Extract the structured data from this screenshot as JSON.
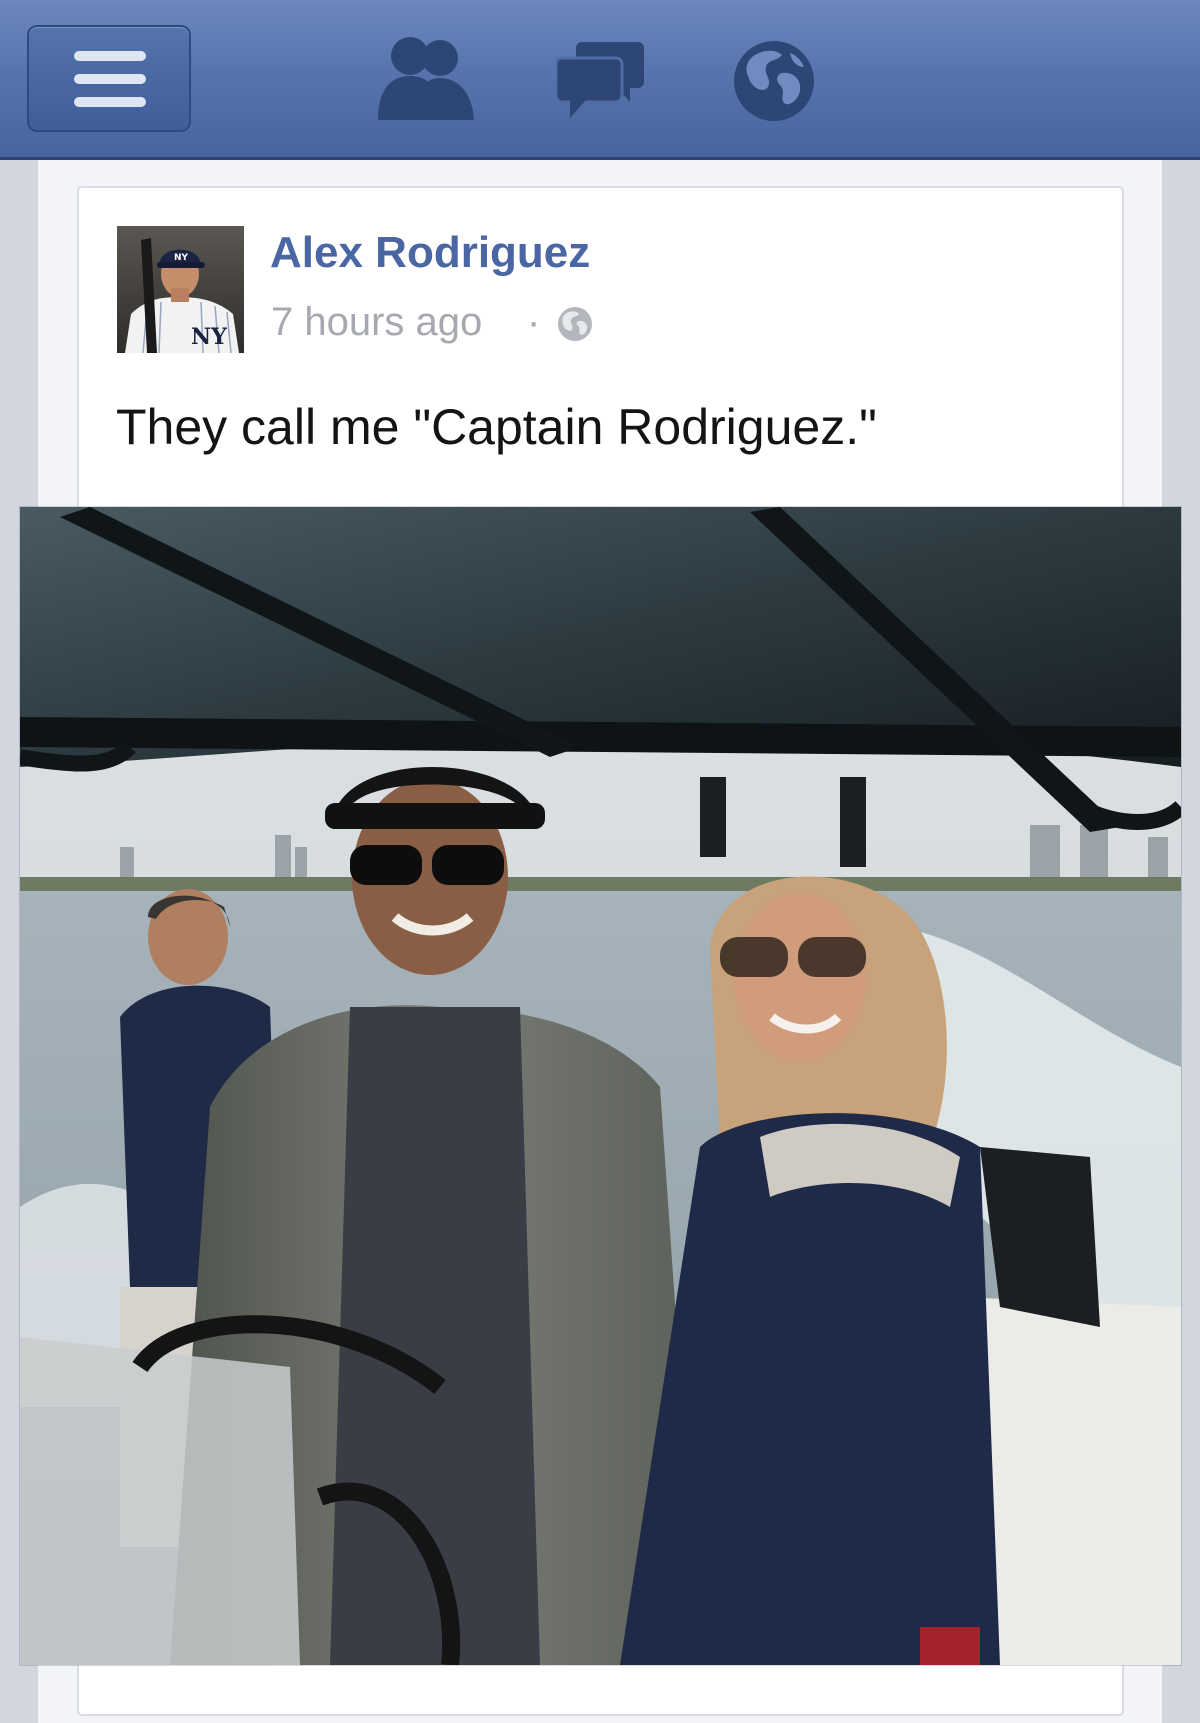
{
  "navbar": {
    "menu_icon": "hamburger-menu-icon",
    "icons": [
      "friends-icon",
      "messages-icon",
      "notifications-globe-icon"
    ],
    "color": "#5874ae"
  },
  "post": {
    "author": "Alex Rodriguez",
    "timestamp": "7 hours ago",
    "separator": "·",
    "privacy_icon": "public-globe-icon",
    "text": "They call me \"Captain Rodriguez.\"",
    "author_color": "#4a67a3"
  }
}
